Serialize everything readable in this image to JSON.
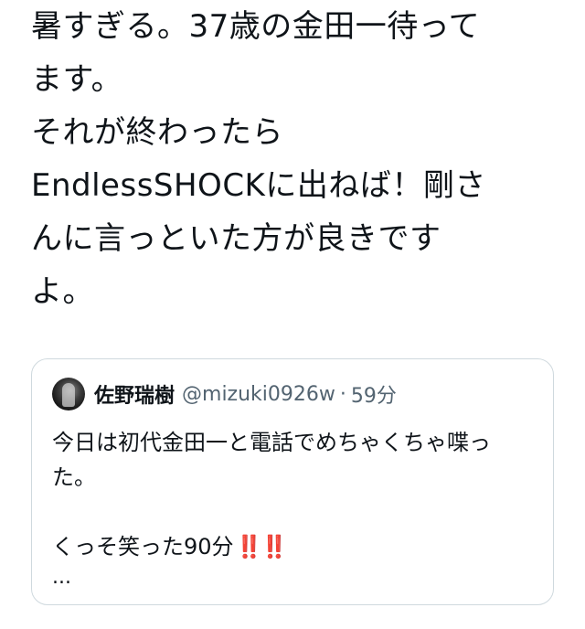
{
  "tweet": {
    "lines": [
      "暑すぎる。37歳の金田一待って",
      "ます。",
      "それが終わったら",
      "EndlessSHOCKに出ねば！剛さ",
      "んに言っといた方が良きです",
      "よ。"
    ]
  },
  "quote": {
    "author_name": "佐野瑞樹",
    "handle": "@mizuki0926w",
    "separator": "·",
    "time": "59分",
    "lines": [
      "今日は初代金田一と電話でめちゃくちゃ喋っ",
      "た。",
      "",
      "くっそ笑った90分"
    ],
    "emphasis": "‼️‼️",
    "truncation": "..."
  },
  "colors": {
    "text": "#0f1419",
    "secondary": "#536471",
    "border": "#cfd9de",
    "emphasis": "#e0245e"
  }
}
